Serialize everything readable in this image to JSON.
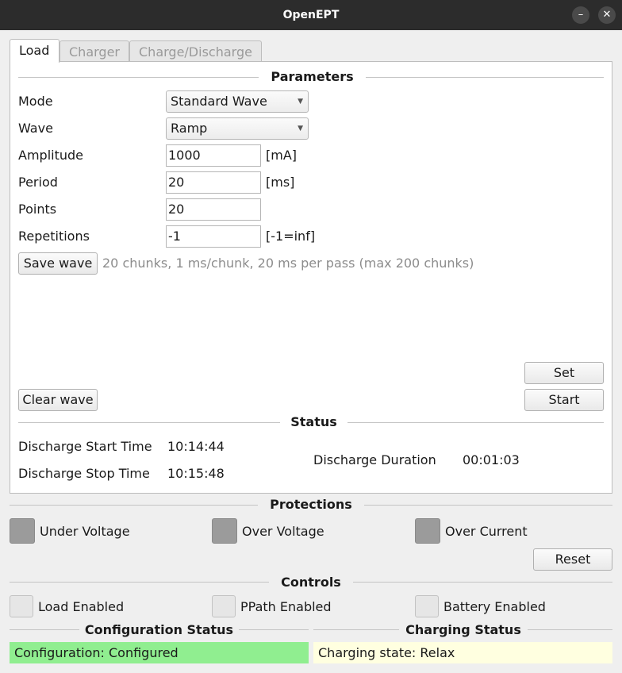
{
  "window": {
    "title": "OpenEPT"
  },
  "tabs": [
    {
      "label": "Load"
    },
    {
      "label": "Charger"
    },
    {
      "label": "Charge/Discharge"
    }
  ],
  "parameters": {
    "title": "Parameters",
    "mode": {
      "label": "Mode",
      "value": "Standard Wave"
    },
    "wave": {
      "label": "Wave",
      "value": "Ramp"
    },
    "amplitude": {
      "label": "Amplitude",
      "value": "1000",
      "unit": "[mA]"
    },
    "period": {
      "label": "Period",
      "value": "20",
      "unit": "[ms]"
    },
    "points": {
      "label": "Points",
      "value": "20"
    },
    "repetitions": {
      "label": "Repetitions",
      "value": "-1",
      "unit": "[-1=inf]"
    },
    "save_wave_label": "Save wave",
    "wave_info": "20 chunks, 1 ms/chunk, 20 ms per pass (max 200 chunks)",
    "clear_wave_label": "Clear wave",
    "set_label": "Set",
    "start_label": "Start"
  },
  "status": {
    "title": "Status",
    "start_time_label": "Discharge Start Time",
    "start_time_value": "10:14:44",
    "stop_time_label": "Discharge Stop Time",
    "stop_time_value": "10:15:48",
    "duration_label": "Discharge Duration",
    "duration_value": "00:01:03"
  },
  "protections": {
    "title": "Protections",
    "under_voltage": "Under Voltage",
    "over_voltage": "Over Voltage",
    "over_current": "Over Current",
    "reset_label": "Reset"
  },
  "controls": {
    "title": "Controls",
    "load_enabled": "Load Enabled",
    "ppath_enabled": "PPath Enabled",
    "battery_enabled": "Battery Enabled"
  },
  "configuration_status": {
    "title": "Configuration Status",
    "text": "Configuration: Configured",
    "color": "#90ee90"
  },
  "charging_status": {
    "title": "Charging Status",
    "text": "Charging state: Relax",
    "color": "#ffffe0"
  }
}
